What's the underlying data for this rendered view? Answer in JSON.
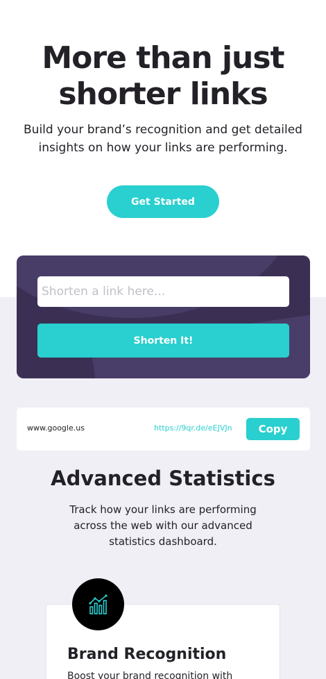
{
  "hero": {
    "title_line1": "More than just",
    "title_line2": "shorter links",
    "subtitle": "Build your brand’s recognition and get detailed insights on how your links are performing.",
    "cta_label": "Get Started"
  },
  "shorten": {
    "placeholder": "Shorten a link here...",
    "button_label": "Shorten It!"
  },
  "results": [
    {
      "original": "www.google.us",
      "short": "https://9qr.de/eEJVJn",
      "copy_label": "Copy"
    }
  ],
  "statistics": {
    "title": "Advanced Statistics",
    "subtitle": "Track how your links are performing across the web with our advanced statistics dashboard."
  },
  "features": [
    {
      "icon": "chart-bars-icon",
      "title": "Brand Recognition",
      "text": "Boost your brand recognition with"
    }
  ],
  "colors": {
    "accent": "#2acfcf",
    "dark_violet": "#3b3054",
    "text": "#232127",
    "gray_bg": "#efeff5"
  }
}
